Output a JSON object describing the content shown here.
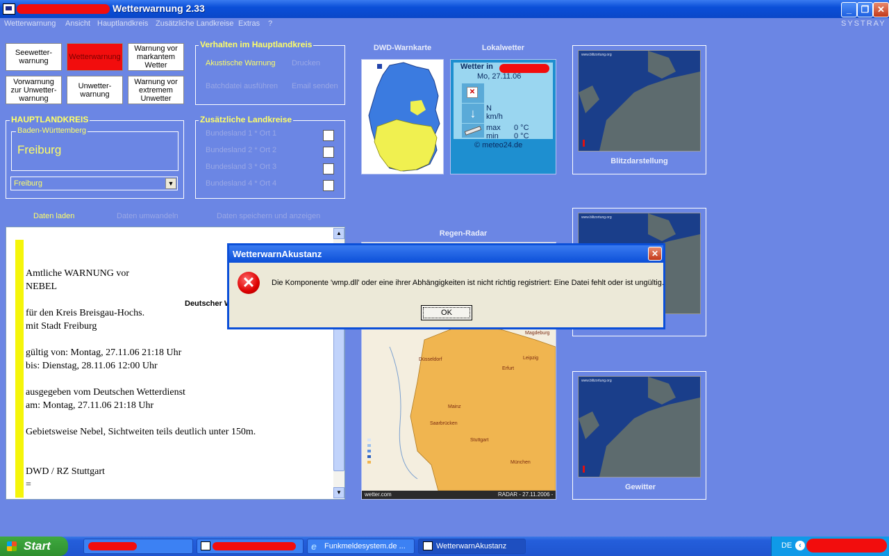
{
  "window": {
    "title": "Wetterwarnung 2.33",
    "btn_min": "_",
    "btn_max": "❐",
    "btn_close": "✕"
  },
  "menu": {
    "items": [
      "Wetterwarnung",
      "Ansicht",
      "Hauptlandkreis",
      "Zusätzliche Landkreise",
      "Extras",
      "?"
    ],
    "systray": "SYSTRAY"
  },
  "warnbuttons": {
    "b1": "Seewetter-\nwarnung",
    "b2": "Wetterwarnung",
    "b3": "Warnung vor\nmarkantem\nWetter",
    "b4": "Vorwarnung\nzur Unwetter-\nwarnung",
    "b5": "Unwetter-\nwarnung",
    "b6": "Warnung vor\nextremem\nUnwetter"
  },
  "verhalten": {
    "title": "Verhalten im Hauptlandkreis",
    "akustisch": "Akustische Warnung",
    "drucken": "Drucken",
    "batch": "Batchdatei ausführen",
    "email": "Email senden"
  },
  "hauptlandkreis": {
    "title": "HAUPTLANDKREIS",
    "land": "Baden-Württemberg",
    "stadt": "Freiburg",
    "select": "Freiburg"
  },
  "zusatz": {
    "title": "Zusätzliche Landkreise",
    "items": [
      "Bundesland 1 * Ort 1",
      "Bundesland 2 * Ort 2",
      "Bundesland 3 * Ort 3",
      "Bundesland 4 * Ort 4"
    ]
  },
  "actions": {
    "laden": "Daten laden",
    "umwandeln": "Daten umwandeln",
    "speichern": "Daten speichern und anzeigen"
  },
  "warntext": {
    "l1": "Amtliche WARNUNG vor",
    "l2": "NEBEL",
    "l3": "für den Kreis Breisgau-Hochs.",
    "l4": "mit Stadt Freiburg",
    "l5": "gültig von: Montag, 27.11.06 21:18 Uhr",
    "l6": "bis: Dienstag, 28.11.06 12:00 Uhr",
    "l7": "ausgegeben vom Deutschen Wetterdienst",
    "l8": "am: Montag, 27.11.06 21:18 Uhr",
    "l9": "Gebietsweise Nebel, Sichtweiten teils deutlich unter 150m.",
    "l10": "DWD / RZ Stuttgart",
    "l11": "=",
    "overlay": "Deutscher W"
  },
  "dwd": {
    "title": "DWD-Warnkarte"
  },
  "lokal": {
    "title": "Lokalwetter",
    "wetter": "Wetter in",
    "date": "Mo, 27.11.06",
    "wind_dir": "N",
    "wind_unit": "km/h",
    "max_label": "max",
    "max_val": "0 °C",
    "min_label": "min",
    "min_val": "0 °C",
    "credit": "© meteo24.de"
  },
  "regen": {
    "title": "Regen-Radar",
    "footer_left": "wetter.com",
    "footer_right": "RADAR - 27.11.2006 -",
    "cities": [
      "Magdeburg",
      "Düsseldorf",
      "Erfurt",
      "Leipzig",
      "Mainz",
      "Saarbrücken",
      "Stuttgart",
      "München"
    ]
  },
  "blitz": {
    "title": "Blitzdarstellung",
    "site": "www.blitzortung.org"
  },
  "gewitter": {
    "title": "Gewitter"
  },
  "dialog": {
    "title": "WetterwarnAkustanz",
    "message": "Die Komponente 'wmp.dll' oder eine ihrer Abhängigkeiten ist nicht richtig registriert: Eine Datei fehlt oder ist ungültig.",
    "ok": "OK",
    "close": "✕"
  },
  "taskbar": {
    "start": "Start",
    "task3": "Funkmeldesystem.de ...",
    "task4": "WetterwarnAkustanz",
    "lang": "DE"
  },
  "colors": {
    "background": "#6b86e4",
    "accent_yellow": "#ffff66",
    "redact": "#f20d0d"
  }
}
